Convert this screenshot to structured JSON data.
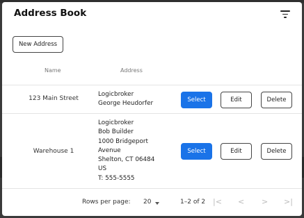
{
  "dialog": {
    "title": "Address Book",
    "new_address_label": "New Address"
  },
  "table": {
    "headers": {
      "name": "Name",
      "address": "Address"
    },
    "rows": [
      {
        "name": "123 Main Street",
        "address_lines": [
          "Logicbroker",
          "George Heudorfer"
        ],
        "select_label": "Select",
        "edit_label": "Edit",
        "delete_label": "Delete"
      },
      {
        "name": "Warehouse 1",
        "address_lines": [
          "Logicbroker",
          "Bob Builder",
          "1000 Bridgeport",
          "Avenue",
          "Shelton, CT 06484",
          "US",
          "T: 555-5555"
        ],
        "select_label": "Select",
        "edit_label": "Edit",
        "delete_label": "Delete"
      }
    ]
  },
  "pagination": {
    "rows_per_page_label": "Rows per page:",
    "rows_per_page_value": "20",
    "range_text": "1–2 of 2",
    "first_icon": "|<",
    "prev_icon": "<",
    "next_icon": ">",
    "last_icon": ">|"
  },
  "colors": {
    "primary": "#1a73e8"
  },
  "icons": {
    "filter": "filter-list-icon"
  }
}
